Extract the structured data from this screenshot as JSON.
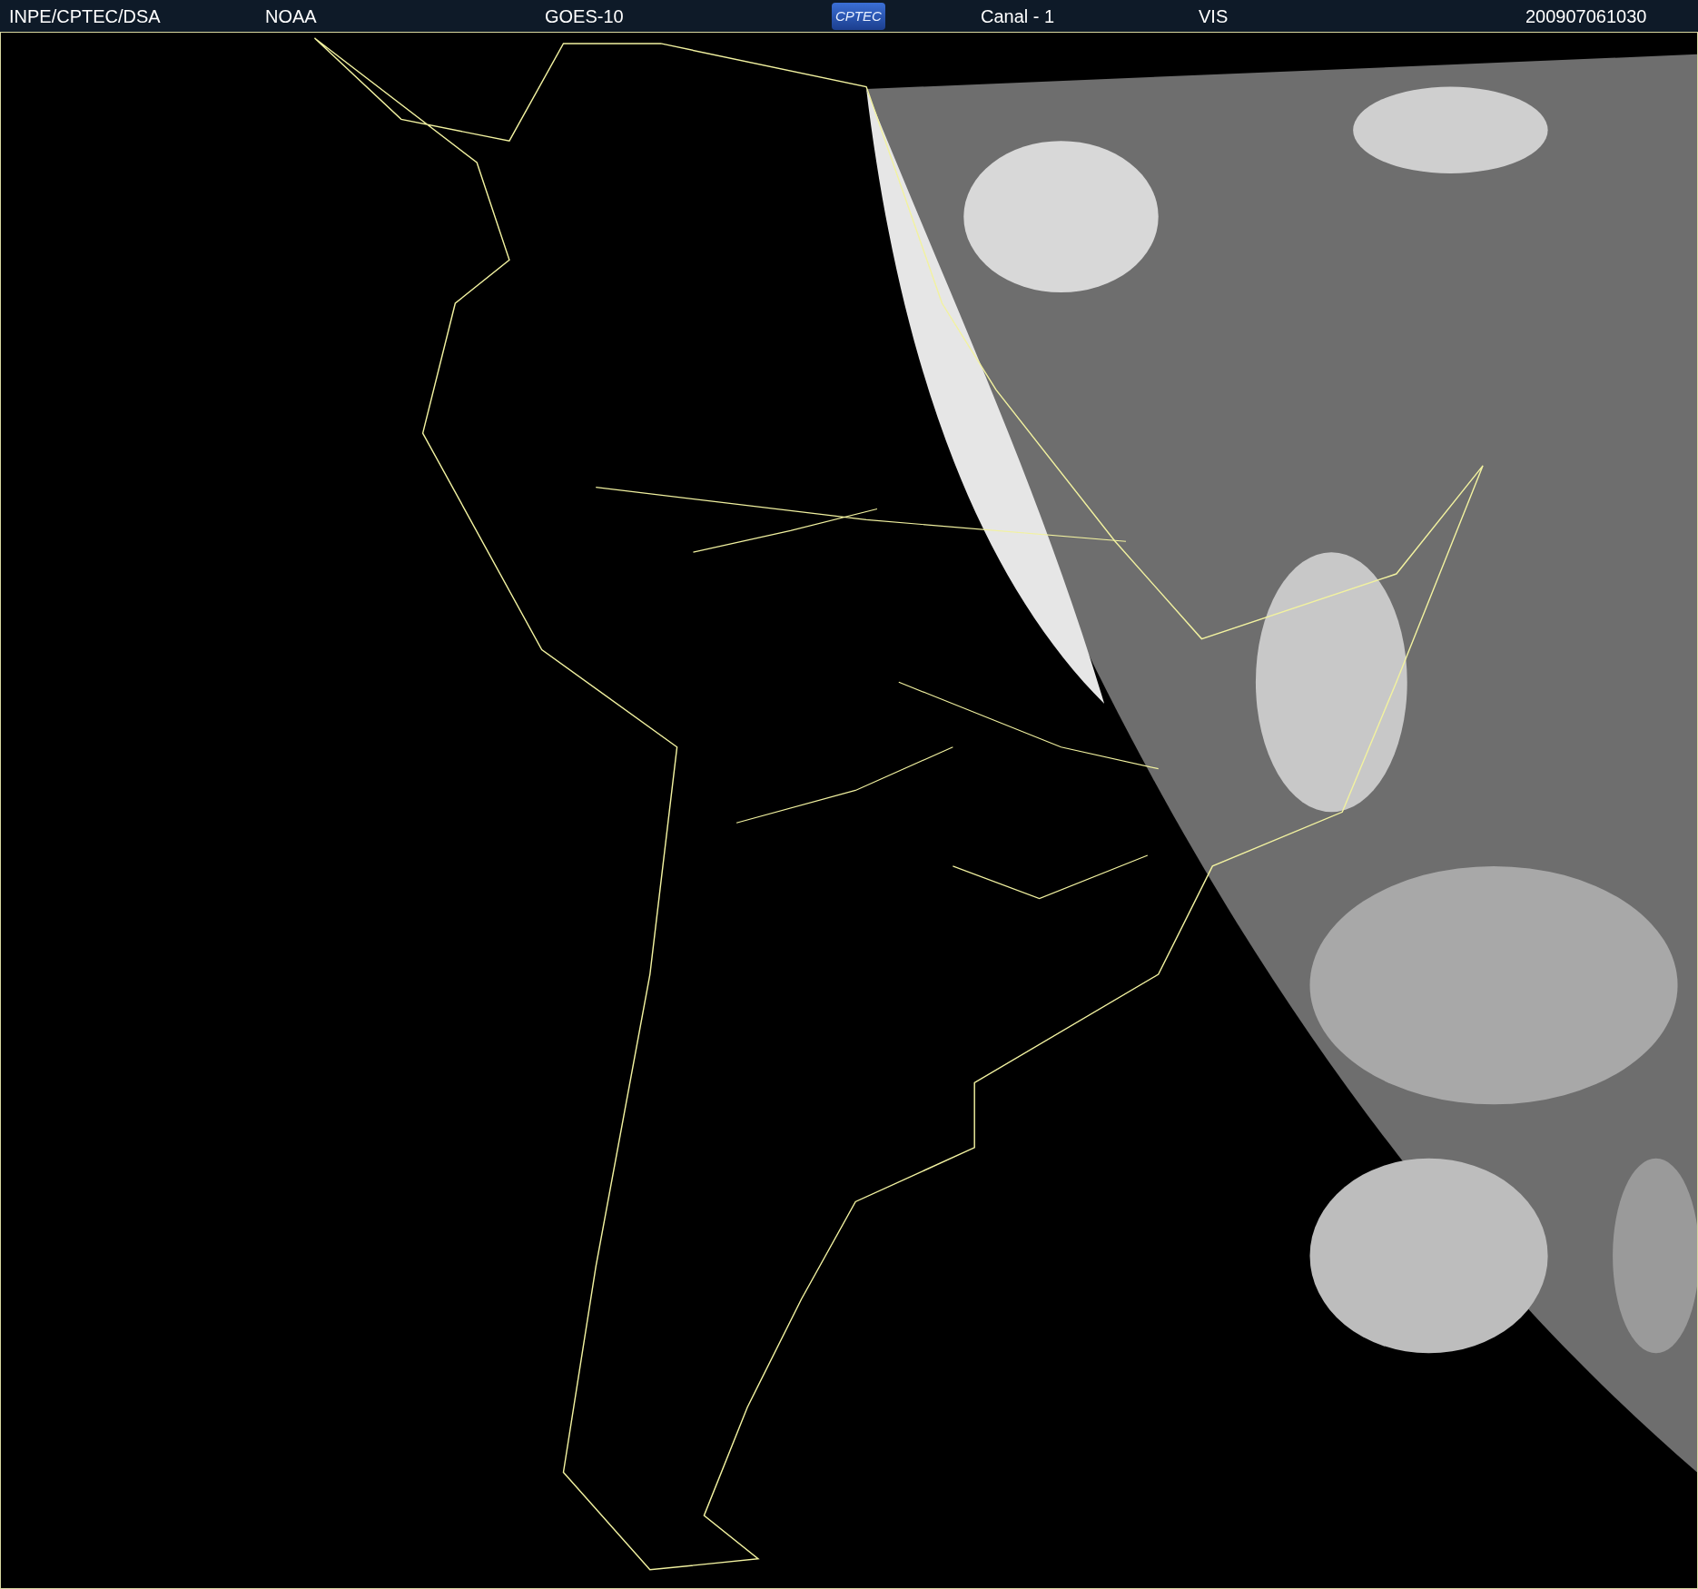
{
  "header": {
    "items": [
      {
        "kind": "text",
        "text": "INPE/CPTEC/DSA"
      },
      {
        "kind": "text",
        "text": "NOAA"
      },
      {
        "kind": "text",
        "text": "GOES-10"
      },
      {
        "kind": "logo",
        "text": "CPTEC"
      },
      {
        "kind": "text",
        "text": "Canal - 1"
      },
      {
        "kind": "text",
        "text": "VIS"
      },
      {
        "kind": "text",
        "text": "200907061030"
      }
    ]
  }
}
